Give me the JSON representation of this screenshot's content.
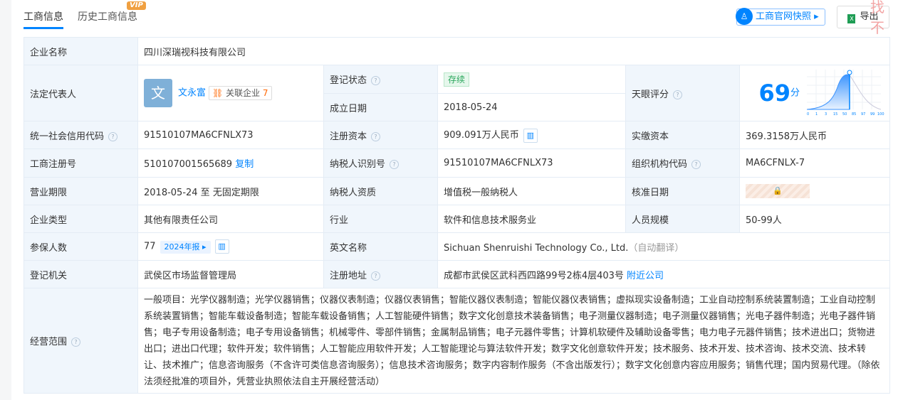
{
  "tabs": [
    {
      "label": "工商信息"
    },
    {
      "label": "历史工商信息"
    }
  ],
  "vip": "VIP",
  "snapshot_label": "工商官网快照",
  "export_label": "导出",
  "stamp": "找不",
  "company_name_label": "企业名称",
  "company_name": "四川深瑞视科技有限公司",
  "legal_rep_label": "法定代表人",
  "legal_rep_avatar": "文",
  "legal_rep": "文永富",
  "related_label": "关联企业",
  "related_count": "7",
  "status_label": "登记状态",
  "status": "存续",
  "established_label": "成立日期",
  "established": "2018-05-24",
  "score_label": "天眼评分",
  "score": "69",
  "score_unit": "分",
  "score_axis": [
    "0",
    "1",
    "3",
    "15",
    "50",
    "85",
    "97",
    "99",
    "100"
  ],
  "credit_code_label": "统一社会信用代码",
  "credit_code": "91510107MA6CFNLX73",
  "reg_capital_label": "注册资本",
  "reg_capital": "909.091万人民币",
  "paid_capital_label": "实缴资本",
  "paid_capital": "369.3158万人民币",
  "reg_no_label": "工商注册号",
  "reg_no": "510107001565689",
  "copy_label": "复制",
  "taxpayer_id_label": "纳税人识别号",
  "taxpayer_id": "91510107MA6CFNLX73",
  "org_code_label": "组织机构代码",
  "org_code": "MA6CFNLX-7",
  "term_label": "营业期限",
  "term": "2018-05-24 至 无固定期限",
  "taxpayer_type_label": "纳税人资质",
  "taxpayer_type": "增值税一般纳税人",
  "approved_label": "核准日期",
  "type_label": "企业类型",
  "type": "其他有限责任公司",
  "industry_label": "行业",
  "industry": "软件和信息技术服务业",
  "staff_label": "人员规模",
  "staff": "50-99人",
  "insured_label": "参保人数",
  "insured": "77",
  "report_year": "2024年报",
  "english_label": "英文名称",
  "english": "Sichuan Shenruishi Technology Co., Ltd.",
  "auto_translate": "（自动翻译）",
  "authority_label": "登记机关",
  "authority": "武侯区市场监督管理局",
  "address_label": "注册地址",
  "address": "成都市武侯区武科西四路99号2栋4层403号",
  "nearby": "附近公司",
  "scope_label": "经营范围",
  "scope": "一般项目：光学仪器制造；光学仪器销售；仪器仪表制造；仪器仪表销售；智能仪器仪表制造；智能仪器仪表销售；虚拟现实设备制造；工业自动控制系统装置制造；工业自动控制系统装置销售；智能车载设备制造；智能车载设备销售；人工智能硬件销售；数字文化创意技术装备销售；电子测量仪器制造；电子测量仪器销售；光电子器件制造；光电子器件销售；电子专用设备制造；电子专用设备销售；机械零件、零部件销售；金属制品销售；电子元器件零售；计算机软硬件及辅助设备零售；电力电子元器件销售；技术进出口；货物进出口；进出口代理；软件开发；软件销售；人工智能应用软件开发；人工智能理论与算法软件开发；数字文化创意软件开发；技术服务、技术开发、技术咨询、技术交流、技术转让、技术推广；信息咨询服务（不含许可类信息咨询服务）；信息技术咨询服务；数字内容制作服务（不含出版发行）；数字文化创意内容应用服务；销售代理；国内贸易代理。（除依法须经批准的项目外，凭营业执照依法自主开展经营活动）"
}
